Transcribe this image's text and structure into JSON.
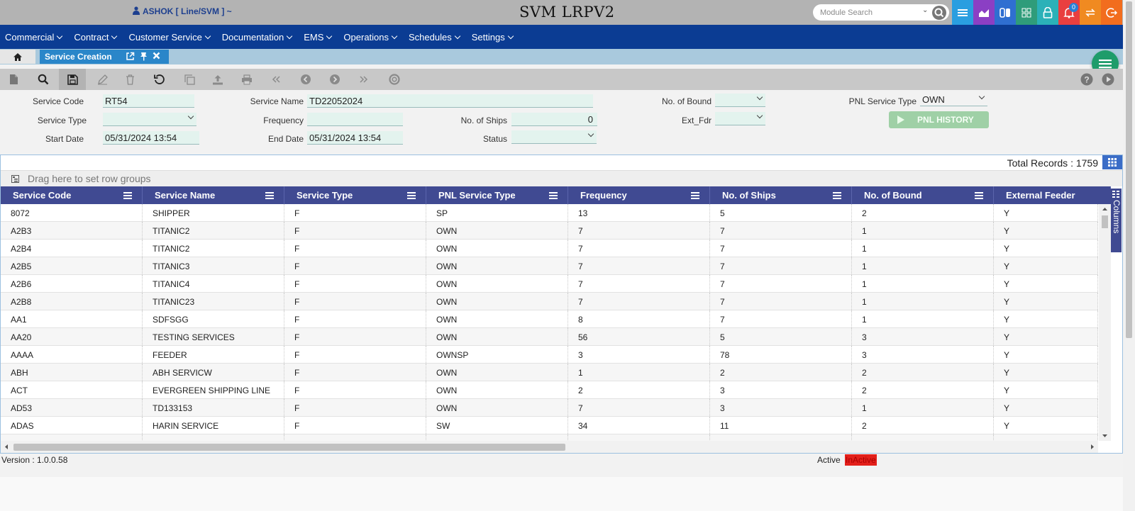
{
  "header": {
    "user": "ASHOK [ Line/SVM ] ~",
    "app_title": "SVM LRPV2",
    "search_placeholder": "Module Search",
    "notification_count": "0",
    "icon_colors": [
      "#2a9ee0",
      "#8b3fc4",
      "#2f6fd1",
      "#2f9c7a",
      "#2bb1b8",
      "#e93f3f",
      "#f08a21",
      "#f26d1e"
    ]
  },
  "nav": {
    "items": [
      "Commercial",
      "Contract",
      "Customer Service",
      "Documentation",
      "EMS",
      "Operations",
      "Schedules",
      "Settings"
    ]
  },
  "tabs": {
    "active": "Service Creation"
  },
  "form": {
    "service_code_label": "Service Code",
    "service_code": "RT54",
    "service_name_label": "Service Name",
    "service_name": "TD22052024",
    "no_of_bound_label": "No. of Bound",
    "pnl_service_type_label": "PNL Service Type",
    "pnl_service_type": "OWN",
    "service_type_label": "Service Type",
    "frequency_label": "Frequency",
    "no_of_ships_label": "No. of Ships",
    "no_of_ships": "0",
    "ext_fdr_label": "Ext_Fdr",
    "pnl_history_button": "PNL HISTORY",
    "start_date_label": "Start Date",
    "start_date": "05/31/2024 13:54",
    "end_date_label": "End Date",
    "end_date": "05/31/2024 13:54",
    "status_label": "Status"
  },
  "grid": {
    "total_records": "Total Records :  1759",
    "row_group_hint": "Drag here to set row groups",
    "columns_tab": "Columns",
    "columns": [
      "Service Code",
      "Service Name",
      "Service Type",
      "PNL Service Type",
      "Frequency",
      "No. of Ships",
      "No. of Bound",
      "External Feeder"
    ],
    "rows": [
      [
        "8072",
        "SHIPPER",
        "F",
        "SP",
        "13",
        "5",
        "2",
        "Y"
      ],
      [
        "A2B3",
        "TITANIC2",
        "F",
        "OWN",
        "7",
        "7",
        "1",
        "Y"
      ],
      [
        "A2B4",
        "TITANIC2",
        "F",
        "OWN",
        "7",
        "7",
        "1",
        "Y"
      ],
      [
        "A2B5",
        "TITANIC3",
        "F",
        "OWN",
        "7",
        "7",
        "1",
        "Y"
      ],
      [
        "A2B6",
        "TITANIC4",
        "F",
        "OWN",
        "7",
        "7",
        "1",
        "Y"
      ],
      [
        "A2B8",
        "TITANIC23",
        "F",
        "OWN",
        "7",
        "7",
        "1",
        "Y"
      ],
      [
        "AA1",
        "SDFSGG",
        "F",
        "OWN",
        "8",
        "7",
        "1",
        "Y"
      ],
      [
        "AA20",
        "TESTING SERVICES",
        "F",
        "OWN",
        "56",
        "5",
        "3",
        "Y"
      ],
      [
        "AAAA",
        "FEEDER",
        "F",
        "OWNSP",
        "3",
        "78",
        "3",
        "Y"
      ],
      [
        "ABH",
        "ABH SERVICW",
        "F",
        "OWN",
        "1",
        "2",
        "2",
        "Y"
      ],
      [
        "ACT",
        "EVERGREEN SHIPPING LINE",
        "F",
        "OWN",
        "2",
        "3",
        "2",
        "Y"
      ],
      [
        "AD53",
        "TD133153",
        "F",
        "OWN",
        "7",
        "3",
        "1",
        "Y"
      ],
      [
        "ADAS",
        "HARIN SERVICE",
        "F",
        "SW",
        "34",
        "11",
        "2",
        "Y"
      ],
      [
        "",
        "",
        "",
        "",
        "",
        "",
        "",
        ""
      ]
    ]
  },
  "footer": {
    "version": "Version : 1.0.0.58",
    "active": "Active",
    "inactive": "InActive"
  }
}
